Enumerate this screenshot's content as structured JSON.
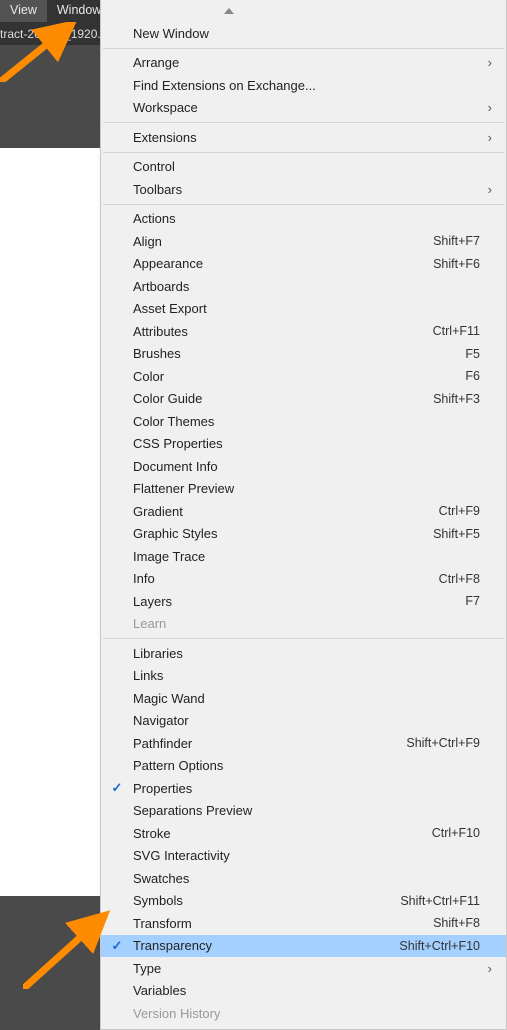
{
  "menubar": {
    "view": "View",
    "window": "Window"
  },
  "tab": {
    "label": "tract-26779     _1920."
  },
  "menu": {
    "new_window": "New Window",
    "arrange": "Arrange",
    "find_ext": "Find Extensions on Exchange...",
    "workspace": "Workspace",
    "extensions": "Extensions",
    "control": "Control",
    "toolbars": "Toolbars",
    "actions": "Actions",
    "align": "Align",
    "align_sc": "Shift+F7",
    "appearance": "Appearance",
    "appearance_sc": "Shift+F6",
    "artboards": "Artboards",
    "asset_export": "Asset Export",
    "attributes": "Attributes",
    "attributes_sc": "Ctrl+F11",
    "brushes": "Brushes",
    "brushes_sc": "F5",
    "color": "Color",
    "color_sc": "F6",
    "color_guide": "Color Guide",
    "color_guide_sc": "Shift+F3",
    "color_themes": "Color Themes",
    "css_properties": "CSS Properties",
    "document_info": "Document Info",
    "flattener_preview": "Flattener Preview",
    "gradient": "Gradient",
    "gradient_sc": "Ctrl+F9",
    "graphic_styles": "Graphic Styles",
    "graphic_styles_sc": "Shift+F5",
    "image_trace": "Image Trace",
    "info": "Info",
    "info_sc": "Ctrl+F8",
    "layers": "Layers",
    "layers_sc": "F7",
    "learn": "Learn",
    "libraries": "Libraries",
    "links": "Links",
    "magic_wand": "Magic Wand",
    "navigator": "Navigator",
    "pathfinder": "Pathfinder",
    "pathfinder_sc": "Shift+Ctrl+F9",
    "pattern_options": "Pattern Options",
    "properties": "Properties",
    "separations_preview": "Separations Preview",
    "stroke": "Stroke",
    "stroke_sc": "Ctrl+F10",
    "svg_interactivity": "SVG Interactivity",
    "swatches": "Swatches",
    "symbols": "Symbols",
    "symbols_sc": "Shift+Ctrl+F11",
    "transform": "Transform",
    "transform_sc": "Shift+F8",
    "transparency": "Transparency",
    "transparency_sc": "Shift+Ctrl+F10",
    "type": "Type",
    "variables": "Variables",
    "version_history": "Version History"
  }
}
